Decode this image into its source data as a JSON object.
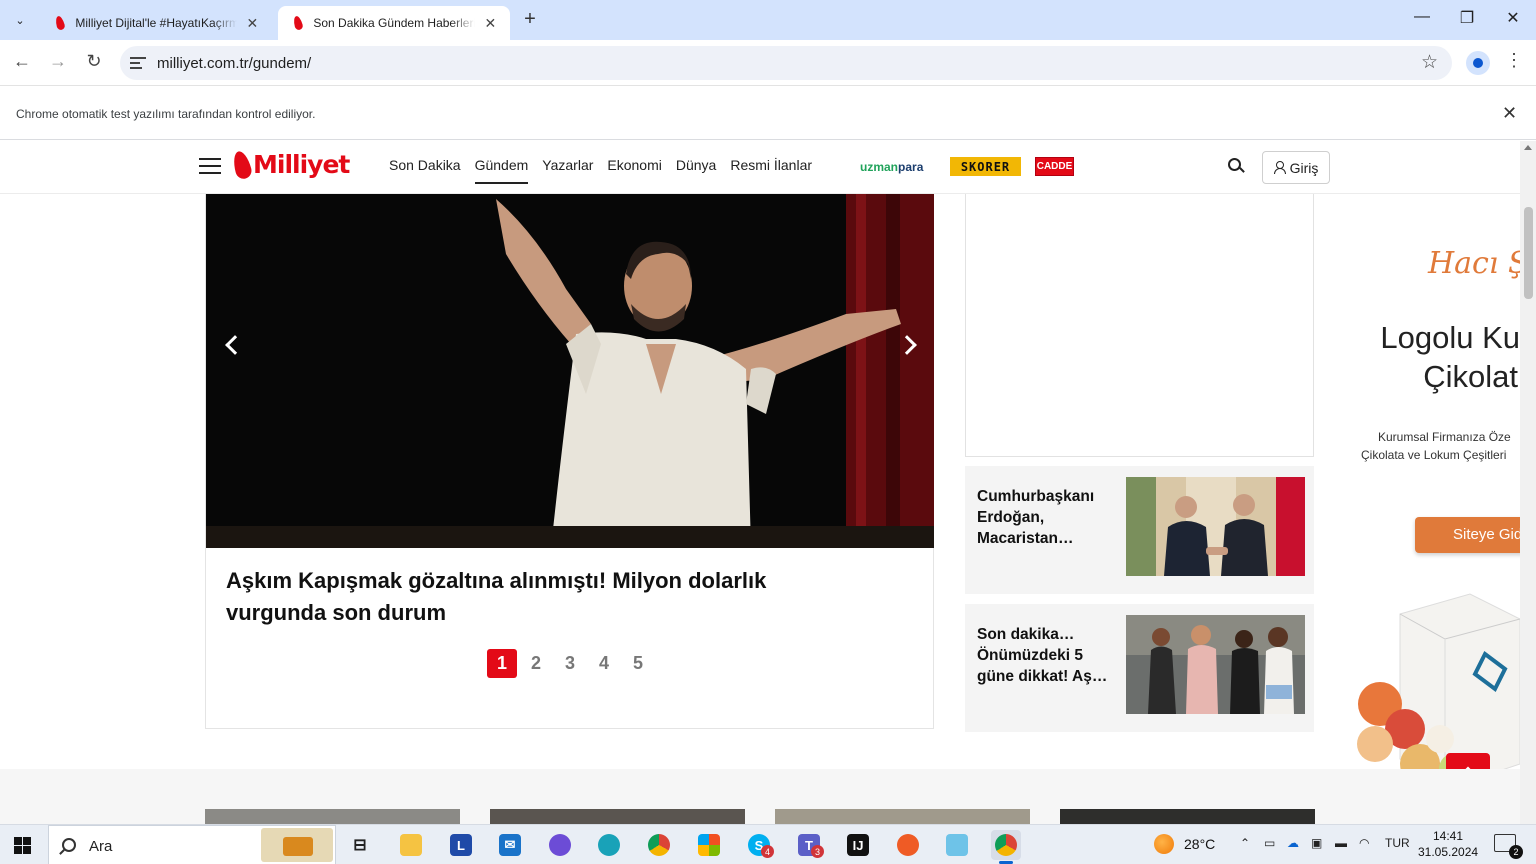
{
  "browser": {
    "tabs": [
      {
        "title": "Milliyet Dijital'le #HayatıKaçırma",
        "active": false
      },
      {
        "title": "Son Dakika Gündem Haberleri - M",
        "active": true
      }
    ],
    "new_tab": "+",
    "url": "milliyet.com.tr/gundem/",
    "automation_notice": "Chrome otomatik test yazılımı tarafından kontrol ediliyor.",
    "window_controls": {
      "minimize": "—",
      "restore": "❐",
      "close": "✕"
    },
    "nav": {
      "back": "←",
      "forward": "→",
      "reload": "↻"
    }
  },
  "site": {
    "logo_text": "Milliyet",
    "nav": [
      {
        "label": "Son Dakika",
        "active": false
      },
      {
        "label": "Gündem",
        "active": true
      },
      {
        "label": "Yazarlar",
        "active": false
      },
      {
        "label": "Ekonomi",
        "active": false
      },
      {
        "label": "Dünya",
        "active": false
      },
      {
        "label": "Resmi İlanlar",
        "active": false
      }
    ],
    "partners": {
      "uzman_a": "uzman",
      "uzman_b": "para",
      "skorer": "SKORER",
      "cadde": "CADDE"
    },
    "login_label": "Giriş",
    "accent": "#e30a17"
  },
  "slider": {
    "title": "Aşkım Kapışmak gözaltına alınmıştı! Milyon dolarlık vurgunda son durum",
    "pages": [
      "1",
      "2",
      "3",
      "4",
      "5"
    ],
    "current_page": 1
  },
  "side_news": [
    {
      "title": "Cumhurbaşkanı Erdoğan, Macaristan…"
    },
    {
      "title": "Son dakika… Önümüzdeki 5 güne dikkat! Aş…"
    }
  ],
  "side_ad": {
    "brand": "Hacı Şe",
    "headline_line1": "Logolu Ku",
    "headline_line2": "Çikolat",
    "sub_line1": "Kurumsal Firmanıza Öze",
    "sub_line2": "Çikolata ve Lokum Çeşitleri",
    "cta": "Siteye Gid",
    "accent": "#e07a3a"
  },
  "taskbar": {
    "search_label": "Ara",
    "weather": "28°C",
    "language": "TUR",
    "time": "14:41",
    "date": "31.05.2024",
    "notifications": "2",
    "skype_badge": "4",
    "teams_badge": "3"
  }
}
